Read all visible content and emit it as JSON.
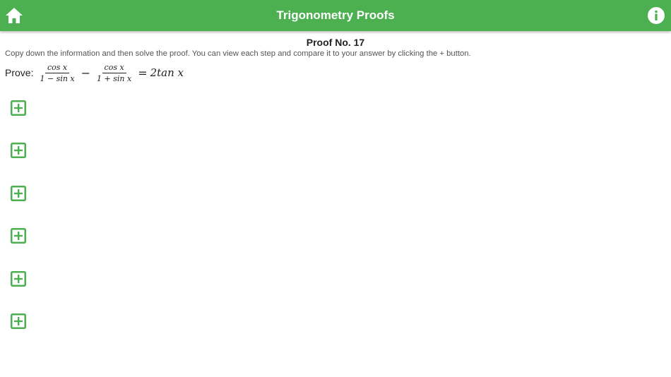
{
  "header": {
    "title": "Trigonometry Proofs",
    "home_icon": "home-icon",
    "info_icon": "info-icon",
    "color": "#4caf50"
  },
  "proof": {
    "title": "Proof No. 17",
    "instructions": "Copy down the information and then solve the proof. You can view each step and compare it to your answer by clicking the + button.",
    "prove_label": "Prove:",
    "frac1_num": "cos x",
    "frac1_den": "1 − sin x",
    "minus": "−",
    "frac2_num": "cos x",
    "frac2_den": "1 + sin x",
    "equals": "=",
    "rhs": "2tan x"
  },
  "steps": {
    "icon": "plus-box-icon",
    "count": 6,
    "color": "#4caf50"
  }
}
